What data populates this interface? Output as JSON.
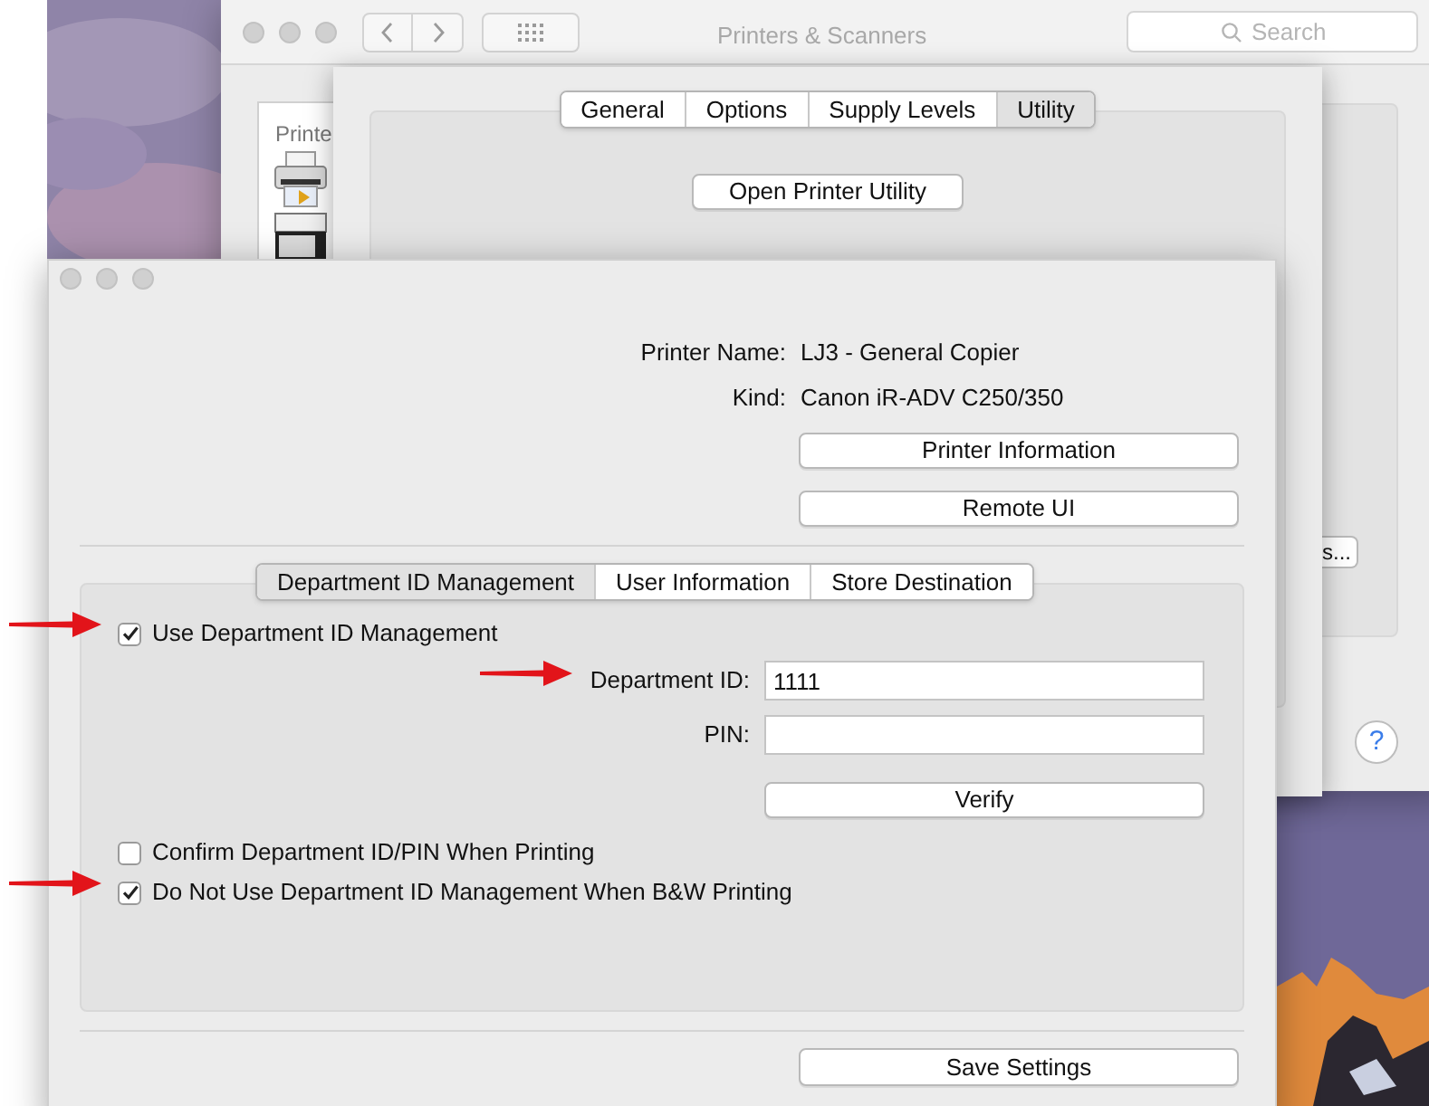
{
  "back_window": {
    "title": "Printers & Scanners",
    "search": {
      "placeholder": "Search"
    },
    "sidebar_heading": "Printe",
    "partial_button": "s...",
    "help_button": "?"
  },
  "sheet": {
    "tabs": [
      {
        "label": "General",
        "selected": false
      },
      {
        "label": "Options",
        "selected": false
      },
      {
        "label": "Supply Levels",
        "selected": false
      },
      {
        "label": "Utility",
        "selected": true
      }
    ],
    "button": "Open Printer Utility"
  },
  "front_window": {
    "info": [
      {
        "label": "Printer Name:",
        "value": "LJ3 - General Copier"
      },
      {
        "label": "Kind:",
        "value": "Canon iR-ADV C250/350"
      }
    ],
    "buttons": [
      "Printer Information",
      "Remote UI"
    ],
    "tabs": [
      {
        "label": "Department ID Management",
        "selected": true
      },
      {
        "label": "User Information",
        "selected": false
      },
      {
        "label": "Store Destination",
        "selected": false
      }
    ],
    "use_department": {
      "label": "Use Department ID Management",
      "checked": true
    },
    "fields": [
      {
        "label": "Department ID:",
        "value": "1111"
      },
      {
        "label": "PIN:"
      }
    ],
    "verify_button": "Verify",
    "options": [
      {
        "label": "Confirm Department ID/PIN When Printing",
        "checked": false
      },
      {
        "label": "Do Not Use Department ID Management When B&W Printing",
        "checked": true
      }
    ],
    "save_button": "Save Settings"
  }
}
